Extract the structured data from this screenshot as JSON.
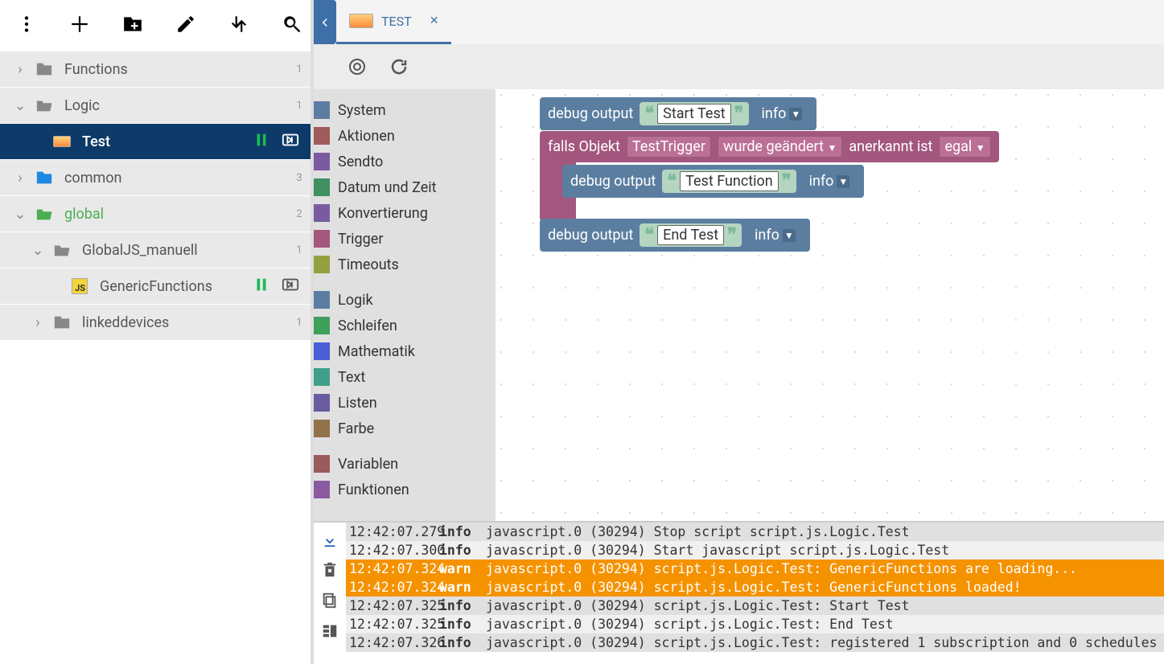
{
  "tree": [
    {
      "indent": 0,
      "kind": "folder",
      "chev": "right",
      "label": "Functions",
      "badge": "1",
      "color": "grey"
    },
    {
      "indent": 0,
      "kind": "folder-open",
      "chev": "down",
      "label": "Logic",
      "badge": "1",
      "color": "grey"
    },
    {
      "indent": 1,
      "kind": "blockly",
      "chev": "",
      "label": "Test",
      "badge": "",
      "active": true,
      "pause": true,
      "run": true
    },
    {
      "indent": 0,
      "kind": "folder",
      "chev": "right",
      "label": "common",
      "badge": "3",
      "color": "blue"
    },
    {
      "indent": 0,
      "kind": "folder-open",
      "chev": "down",
      "label": "global",
      "badge": "2",
      "color": "green",
      "green": true
    },
    {
      "indent": 1,
      "kind": "folder-open",
      "chev": "down",
      "label": "GlobalJS_manuell",
      "badge": "1",
      "color": "grey"
    },
    {
      "indent": 2,
      "kind": "js",
      "chev": "",
      "label": "GenericFunctions",
      "badge": "",
      "pauseG": true,
      "run": true
    },
    {
      "indent": 1,
      "kind": "folder",
      "chev": "right",
      "label": "linkeddevices",
      "badge": "1",
      "color": "grey"
    }
  ],
  "tab": {
    "title": "TEST"
  },
  "categories": [
    {
      "label": "System",
      "color": "#5b7ea0"
    },
    {
      "label": "Aktionen",
      "color": "#a05b5b"
    },
    {
      "label": "Sendto",
      "color": "#7a5ba0"
    },
    {
      "label": "Datum und Zeit",
      "color": "#3f8f5f"
    },
    {
      "label": "Konvertierung",
      "color": "#7a5ba0"
    },
    {
      "label": "Trigger",
      "color": "#a3577e"
    },
    {
      "label": "Timeouts",
      "color": "#94a03e"
    },
    {
      "sep": true
    },
    {
      "label": "Logik",
      "color": "#5b7ea0"
    },
    {
      "label": "Schleifen",
      "color": "#3fa05b"
    },
    {
      "label": "Mathematik",
      "color": "#4a5ed6"
    },
    {
      "label": "Text",
      "color": "#3fa08a"
    },
    {
      "label": "Listen",
      "color": "#6b5ba0"
    },
    {
      "label": "Farbe",
      "color": "#92724a"
    },
    {
      "sep": true
    },
    {
      "label": "Variablen",
      "color": "#9c5b5b"
    },
    {
      "label": "Funktionen",
      "color": "#8a5ba0"
    }
  ],
  "blocks": {
    "debug_label": "debug output",
    "b1_text": "Start Test",
    "b1_level": "info",
    "trig_prefix": "falls Objekt",
    "trig_id": "TestTrigger",
    "trig_op": "wurde geändert",
    "trig_op2": "anerkannt ist",
    "trig_val": "egal",
    "b2_text": "Test Function",
    "b2_level": "info",
    "b3_text": "End Test",
    "b3_level": "info"
  },
  "logs": [
    {
      "t": "12:42:07.279",
      "lv": "info",
      "msg": "javascript.0 (30294) Stop script script.js.Logic.Test"
    },
    {
      "t": "12:42:07.300",
      "lv": "info",
      "msg": "javascript.0 (30294) Start javascript script.js.Logic.Test"
    },
    {
      "t": "12:42:07.324",
      "lv": "warn",
      "msg": "javascript.0 (30294) script.js.Logic.Test: GenericFunctions are loading..."
    },
    {
      "t": "12:42:07.324",
      "lv": "warn",
      "msg": "javascript.0 (30294) script.js.Logic.Test: GenericFunctions loaded!"
    },
    {
      "t": "12:42:07.325",
      "lv": "info",
      "msg": "javascript.0 (30294) script.js.Logic.Test: Start Test"
    },
    {
      "t": "12:42:07.325",
      "lv": "info",
      "msg": "javascript.0 (30294) script.js.Logic.Test: End Test"
    },
    {
      "t": "12:42:07.326",
      "lv": "info",
      "msg": "javascript.0 (30294) script.js.Logic.Test: registered 1 subscription and 0 schedules"
    }
  ]
}
